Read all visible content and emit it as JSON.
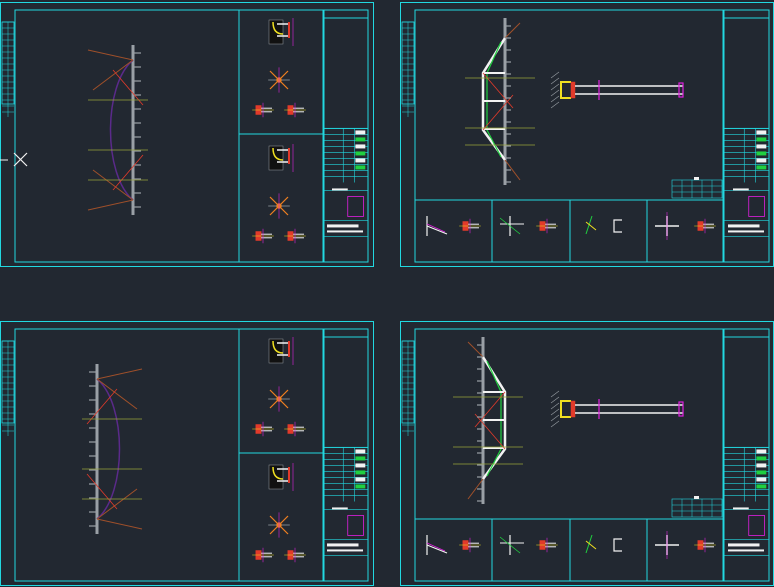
{
  "viewport": {
    "background": "#222831"
  },
  "colors": {
    "frame": "#22d8e0",
    "white": "#f2f2f2",
    "grey": "#9aa0a6",
    "red": "#e23a2a",
    "brown": "#a0502a",
    "olive": "#9aa43a",
    "purple": "#5a2a8a",
    "magenta": "#e020e0",
    "yellow": "#f0e020",
    "orange": "#f08020",
    "green": "#20d040",
    "blue": "#3050e0"
  },
  "sheets": [
    {
      "id": "sheet-a",
      "variant": "section-left",
      "mirror": false
    },
    {
      "id": "sheet-b",
      "variant": "truss-plan",
      "mirror": false
    },
    {
      "id": "sheet-c",
      "variant": "section-left",
      "mirror": true
    },
    {
      "id": "sheet-d",
      "variant": "truss-plan",
      "mirror": true
    }
  ],
  "cursor": {
    "icon": "crosshair-cursor-icon"
  }
}
